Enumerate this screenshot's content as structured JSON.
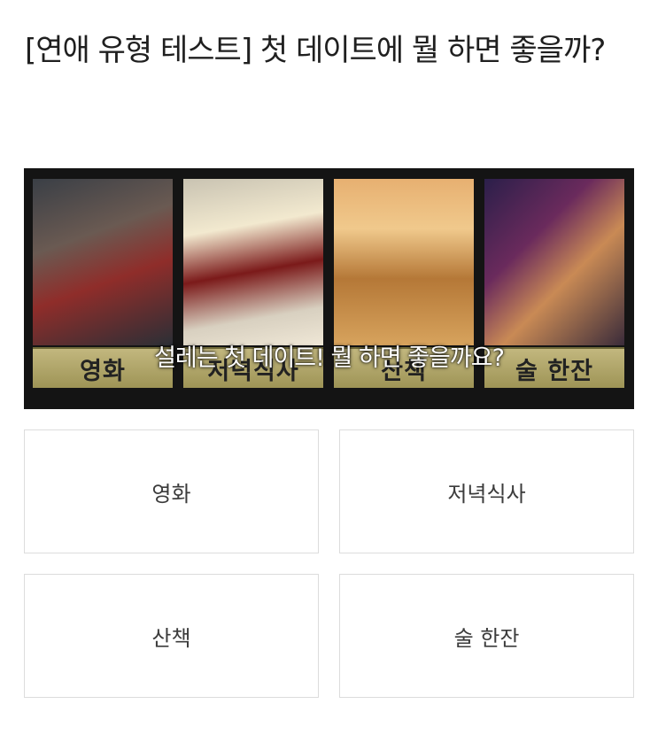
{
  "title": "[연애 유형 테스트] 첫 데이트에 뭘 하면 좋을까?",
  "banner": {
    "question_overlay": "설레는 첫 데이트! 뭘 하면 좋을까요?",
    "panels": [
      {
        "caption": "영화"
      },
      {
        "caption": "저녁식사"
      },
      {
        "caption": "산책"
      },
      {
        "caption": "술 한잔"
      }
    ]
  },
  "choices": [
    "영화",
    "저녁식사",
    "산책",
    "술 한잔"
  ]
}
